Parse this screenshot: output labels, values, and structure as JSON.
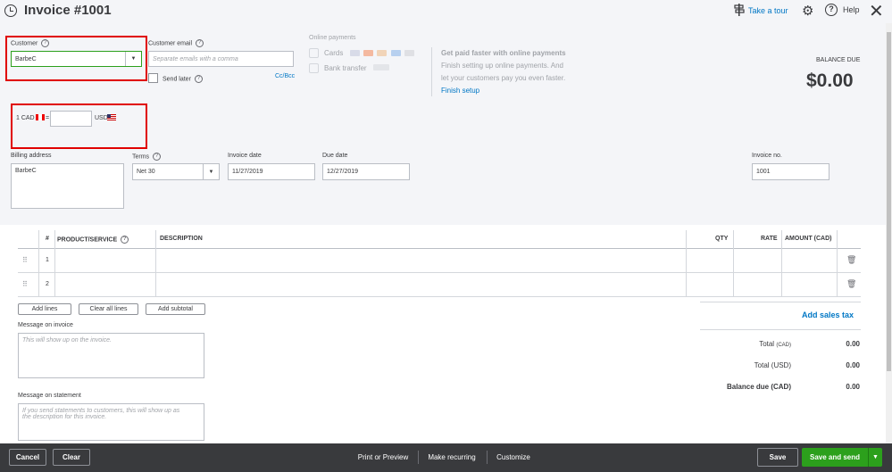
{
  "header": {
    "title": "Invoice #1001",
    "tour_label": "Take a tour",
    "help_label": "Help"
  },
  "customer": {
    "label": "Customer",
    "value": "BarbeC"
  },
  "customer_email": {
    "label": "Customer email",
    "placeholder": "Separate emails with a comma",
    "send_later_label": "Send later",
    "cc_bcc_label": "Cc/Bcc"
  },
  "online_payments": {
    "heading": "Online payments",
    "cards_label": "Cards",
    "bank_label": "Bank transfer",
    "promo_title": "Get paid faster with online payments",
    "promo_line1": "Finish setting up online payments. And",
    "promo_line2": "let your customers pay you even faster.",
    "finish_setup": "Finish setup",
    "card_brands": [
      "VISA",
      "MC",
      "DISC",
      "AMEX",
      "PAY"
    ]
  },
  "balance": {
    "label": "BALANCE DUE",
    "amount": "$0.00"
  },
  "currency": {
    "from": "1 CAD",
    "eq": "=",
    "to": "USD",
    "rate_value": ""
  },
  "billing": {
    "label": "Billing address",
    "value": "BarbeC"
  },
  "terms": {
    "label": "Terms",
    "value": "Net 30"
  },
  "invoice_date": {
    "label": "Invoice date",
    "value": "11/27/2019"
  },
  "due_date": {
    "label": "Due date",
    "value": "12/27/2019"
  },
  "invoice_no": {
    "label": "Invoice no.",
    "value": "1001"
  },
  "table": {
    "columns": {
      "num": "#",
      "product": "PRODUCT/SERVICE",
      "description": "DESCRIPTION",
      "qty": "QTY",
      "rate": "RATE",
      "amount": "AMOUNT (CAD)"
    },
    "rows": [
      {
        "num": "1"
      },
      {
        "num": "2"
      }
    ]
  },
  "line_buttons": {
    "add_lines": "Add lines",
    "clear_all": "Clear all lines",
    "add_subtotal": "Add subtotal"
  },
  "message_invoice": {
    "label": "Message on invoice",
    "placeholder": "This will show up on the invoice."
  },
  "message_statement": {
    "label": "Message on statement",
    "placeholder_line1": "If you send statements to customers, this will show up as",
    "placeholder_line2": "the description for this invoice."
  },
  "totals": {
    "add_sales_tax": "Add sales tax",
    "total_cad_label": "Total",
    "total_cad_unit": "(CAD)",
    "total_cad_value": "0.00",
    "total_usd_label": "Total (USD)",
    "total_usd_value": "0.00",
    "balance_due_label": "Balance due (CAD)",
    "balance_due_value": "0.00"
  },
  "footer": {
    "cancel": "Cancel",
    "clear": "Clear",
    "print_preview": "Print or Preview",
    "make_recurring": "Make recurring",
    "customize": "Customize",
    "save": "Save",
    "save_and_send": "Save and send"
  },
  "colors": {
    "accent_green": "#2ca01c",
    "link_blue": "#0077c5",
    "highlight_red": "#e00000",
    "footer_dark": "#393a3d"
  }
}
